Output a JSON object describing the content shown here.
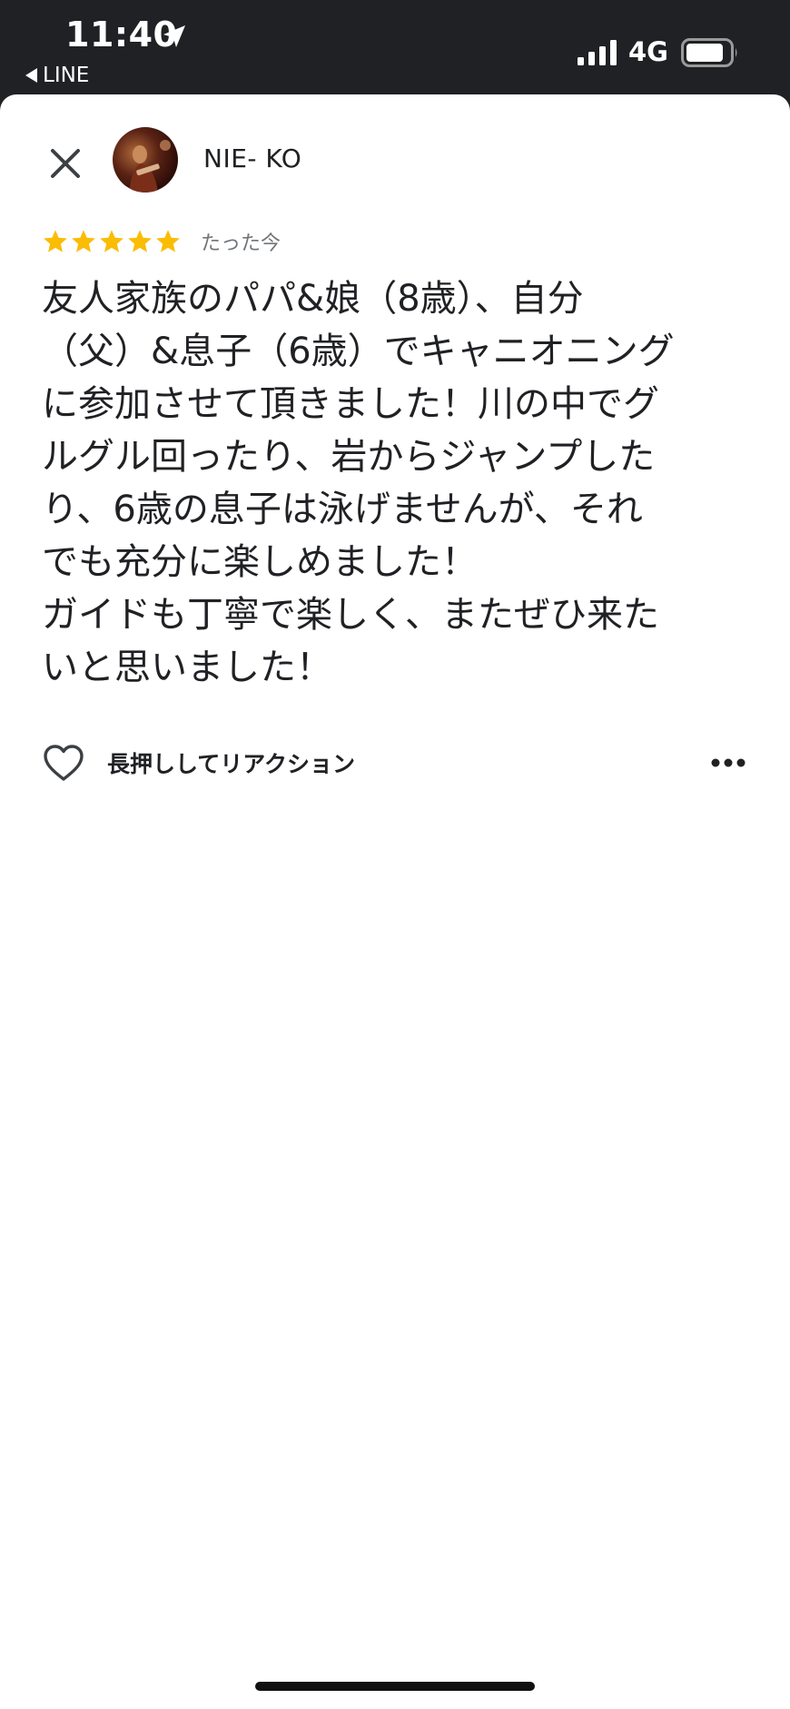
{
  "status_bar": {
    "time": "11:40",
    "back_app_label": "LINE",
    "network": "4G",
    "icons": [
      "location-arrow-icon",
      "signal-bars-icon",
      "battery-icon"
    ]
  },
  "review": {
    "close_icon": "close-icon",
    "user_name": "NIE- KO",
    "rating": 5,
    "rating_max": 5,
    "star_color": "#fbbc04",
    "timestamp": "たった今",
    "text": "友人家族のパパ&娘（8歳）、自分\n（父）&息子（6歳）でキャニオニング\nに参加させて頂きました！川の中でグ\nルグル回ったり、岩からジャンプした\nり、6歳の息子は泳げませんが、それ\nでも充分に楽しめました！\nガイドも丁寧で楽しく、またぜひ来た\nいと思いました！"
  },
  "actions": {
    "heart_icon": "heart-outline-icon",
    "reaction_label": "長押ししてリアクション",
    "more_icon": "more-horizontal-icon"
  },
  "colors": {
    "status_bar_bg": "#202124",
    "sheet_bg": "#ffffff",
    "text_primary": "#202124",
    "text_secondary": "#70757a"
  }
}
